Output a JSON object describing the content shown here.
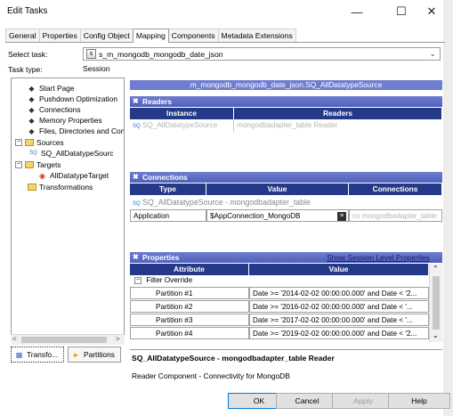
{
  "window": {
    "title": "Edit Tasks",
    "minimize": "—",
    "maximize": "☐",
    "close": "✕"
  },
  "tabs": [
    "General",
    "Properties",
    "Config Object",
    "Mapping",
    "Components",
    "Metadata Extensions"
  ],
  "active_tab": "Mapping",
  "select_task": {
    "label": "Select task:",
    "value": "s_m_mongodb_mongodb_date_json"
  },
  "task_type": {
    "label": "Task type:",
    "value": "Session"
  },
  "tree": {
    "items": [
      {
        "label": "Start Page",
        "icon": "start-icon"
      },
      {
        "label": "Pushdown Optimization",
        "icon": "pushdown-icon"
      },
      {
        "label": "Connections",
        "icon": "connections-icon"
      },
      {
        "label": "Memory Properties",
        "icon": "memory-icon"
      },
      {
        "label": "Files, Directories and Com",
        "icon": "files-icon"
      },
      {
        "label": "Sources",
        "icon": "folder-icon",
        "expander": "−"
      },
      {
        "label": "SQ_AllDatatypeSourc",
        "icon": "source-qualifier-icon"
      },
      {
        "label": "Targets",
        "icon": "folder-icon",
        "expander": "−"
      },
      {
        "label": "AllDatatypeTarget",
        "icon": "target-icon"
      },
      {
        "label": "Transformations",
        "icon": "folder-icon"
      }
    ]
  },
  "bottom_tabs": [
    {
      "label": "Transfo...",
      "icon": "transformations-icon"
    },
    {
      "label": "Partitions",
      "icon": "partitions-icon"
    }
  ],
  "panel_title": "m_mongodb_mongodb_date_json.SQ_AllDatatypeSource",
  "readers": {
    "title": "Readers",
    "columns": [
      "Instance",
      "Readers"
    ],
    "rows": [
      {
        "instance": "SQ_AllDatatypeSource",
        "reader": "mongodbadapter_table Reader"
      }
    ]
  },
  "connections": {
    "title": "Connections",
    "columns": [
      "Type",
      "Value",
      "Connections"
    ],
    "subtitle": "SQ_AllDatatypeSource - mongodbadapter_table",
    "rows": [
      {
        "type": "Application",
        "value": "$AppConnection_MongoDB",
        "connection": "mongodbadapter_table"
      }
    ]
  },
  "properties": {
    "title": "Properties",
    "link": "Show Session Level Properties",
    "columns": [
      "Attribute",
      "Value"
    ],
    "group": "Filter Override",
    "group_toggle": "−",
    "rows": [
      {
        "attribute": "Partition #1",
        "value": "Date >= '2014-02-02 00:00:00.000' and Date < '2..."
      },
      {
        "attribute": "Partition #2",
        "value": "Date >= '2016-02-02 00:00:00.000' and Date < '..."
      },
      {
        "attribute": "Partition #3",
        "value": "Date >= '2017-02-02 00:00:00.000'  and Date < '..."
      },
      {
        "attribute": "Partition #4",
        "value": "Date >= '2019-02-02 00:00:00.000' and Date < '2..."
      }
    ]
  },
  "description": {
    "title": "SQ_AllDatatypeSource - mongodbadapter_table Reader",
    "text": "Reader Component - Connectivity for MongoDB"
  },
  "buttons": {
    "ok": "OK",
    "cancel": "Cancel",
    "apply": "Apply",
    "help": "Help"
  },
  "colors": {
    "section_header": "#6f7ed0",
    "column_header": "#243a88"
  }
}
